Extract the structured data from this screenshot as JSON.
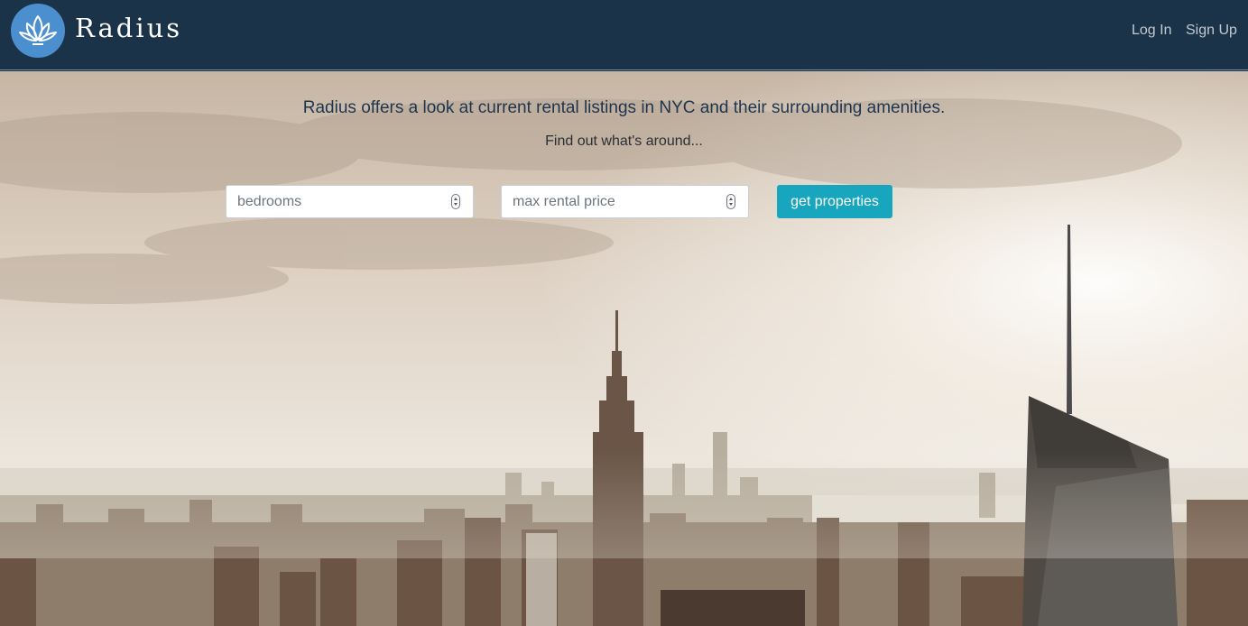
{
  "brand": {
    "name": "Radius"
  },
  "nav": {
    "login": "Log In",
    "signup": "Sign Up"
  },
  "hero": {
    "tagline": "Radius offers a look at current rental listings in NYC and their surrounding amenities.",
    "subline": "Find out what's around..."
  },
  "search": {
    "bedrooms_placeholder": "bedrooms",
    "price_placeholder": "max rental price",
    "button_label": "get properties"
  },
  "colors": {
    "navbar": "#1b3349",
    "logo": "#4b8fce",
    "button": "#17a6be"
  },
  "icons": {
    "logo": "lotus-icon",
    "spinner": "number-spinner-icon"
  }
}
